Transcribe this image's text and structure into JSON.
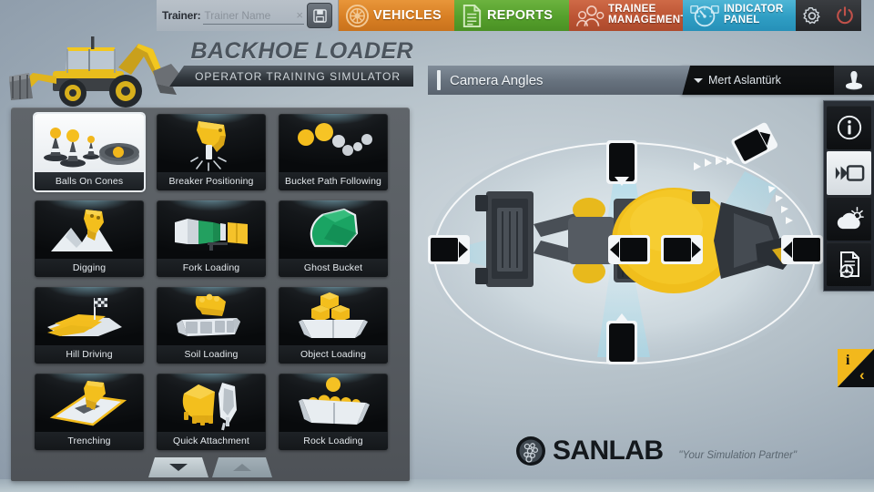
{
  "topbar": {
    "trainer_label": "Trainer:",
    "trainer_placeholder": "Trainer Name",
    "trainer_value": "",
    "clear_symbol": "×",
    "save_icon": "floppy-disk-icon",
    "tabs": [
      {
        "id": "vehicles",
        "label": "VEHICLES",
        "icon": "wheel-icon",
        "color": "#d87f24"
      },
      {
        "id": "reports",
        "label": "REPORTS",
        "icon": "document-icon",
        "color": "#55a02c"
      },
      {
        "id": "trainee",
        "label_line1": "TRAINEE",
        "label_line2": "MANAGEMENT",
        "icon": "people-icon",
        "color": "#bc5434"
      },
      {
        "id": "indicator",
        "label_line1": "INDICATOR",
        "label_line2": "PANEL",
        "icon": "gauge-icon",
        "color": "#2f9ec4"
      }
    ],
    "settings_icon": "gear-icon",
    "power_icon": "power-icon"
  },
  "banner": {
    "title": "BACKHOE LOADER",
    "subtitle": "OPERATOR TRAINING SIMULATOR",
    "machine_icon": "backhoe-loader-illustration"
  },
  "exercises": {
    "selected_index": 0,
    "tiles": [
      {
        "label": "Balls On Cones",
        "icon": "balls-on-cones-icon"
      },
      {
        "label": "Breaker Positioning",
        "icon": "breaker-positioning-icon"
      },
      {
        "label": "Bucket Path Following",
        "icon": "bucket-path-following-icon"
      },
      {
        "label": "Digging",
        "icon": "digging-icon"
      },
      {
        "label": "Fork Loading",
        "icon": "fork-loading-icon"
      },
      {
        "label": "Ghost Bucket",
        "icon": "ghost-bucket-icon"
      },
      {
        "label": "Hill Driving",
        "icon": "hill-driving-icon"
      },
      {
        "label": "Soil Loading",
        "icon": "soil-loading-icon"
      },
      {
        "label": "Object Loading",
        "icon": "object-loading-icon"
      },
      {
        "label": "Trenching",
        "icon": "trenching-icon"
      },
      {
        "label": "Quick Attachment",
        "icon": "quick-attachment-icon"
      },
      {
        "label": "Rock Loading",
        "icon": "rock-loading-icon"
      }
    ],
    "scroll_down_icon": "chevron-down-icon",
    "scroll_up_icon": "chevron-up-icon"
  },
  "camera": {
    "header_title": "Camera Angles",
    "user_name": "Mert Aslantürk",
    "user_caret_icon": "caret-down-icon",
    "joystick_icon": "joystick-icon",
    "markers": [
      {
        "id": "cam-top",
        "type": "camera-marker",
        "angle": "top"
      },
      {
        "id": "cam-top-right",
        "type": "camera-marker",
        "angle": "top-right"
      },
      {
        "id": "cam-left",
        "type": "camera-marker",
        "angle": "left"
      },
      {
        "id": "cam-right",
        "type": "camera-marker",
        "angle": "right"
      },
      {
        "id": "cam-center-left",
        "type": "camera-marker",
        "angle": "center-left"
      },
      {
        "id": "cam-center-right",
        "type": "camera-marker",
        "angle": "center-right"
      },
      {
        "id": "cam-bottom",
        "type": "camera-marker",
        "angle": "bottom"
      }
    ],
    "vehicle_icon": "backhoe-top-view"
  },
  "rail": {
    "active_index": 1,
    "buttons": [
      {
        "id": "info",
        "icon": "info-circle-icon"
      },
      {
        "id": "camera",
        "icon": "video-camera-icon"
      },
      {
        "id": "weather",
        "icon": "weather-cloud-sun-icon"
      },
      {
        "id": "report",
        "icon": "report-steering-icon"
      }
    ],
    "info_tab_icon": "info-collapse-tab-icon",
    "info_tab_letter": "i",
    "info_tab_chevron": "‹"
  },
  "footer": {
    "brand": "SANLAB",
    "brand_icon": "sanlab-logo-icon",
    "slogan": "\"Your Simulation Partner\""
  },
  "colors": {
    "accent_orange": "#d87f24",
    "accent_green": "#55a02c",
    "accent_red": "#bc5434",
    "accent_blue": "#2f9ec4",
    "machine_yellow": "#f0bc1e",
    "panel_gray": "#585d62",
    "tile_dark": "#0d1012"
  }
}
